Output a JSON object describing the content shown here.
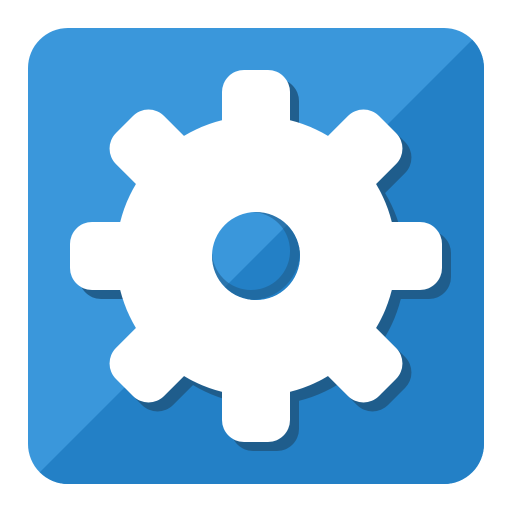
{
  "icon": {
    "name": "gear-icon",
    "colors": {
      "tile_light": "#3A97DB",
      "tile_dark": "#2380C6",
      "gear": "#FFFFFF",
      "shadow": "#1F5A86",
      "hole_light": "#3A97DB",
      "hole_dark": "#2380C6"
    }
  }
}
